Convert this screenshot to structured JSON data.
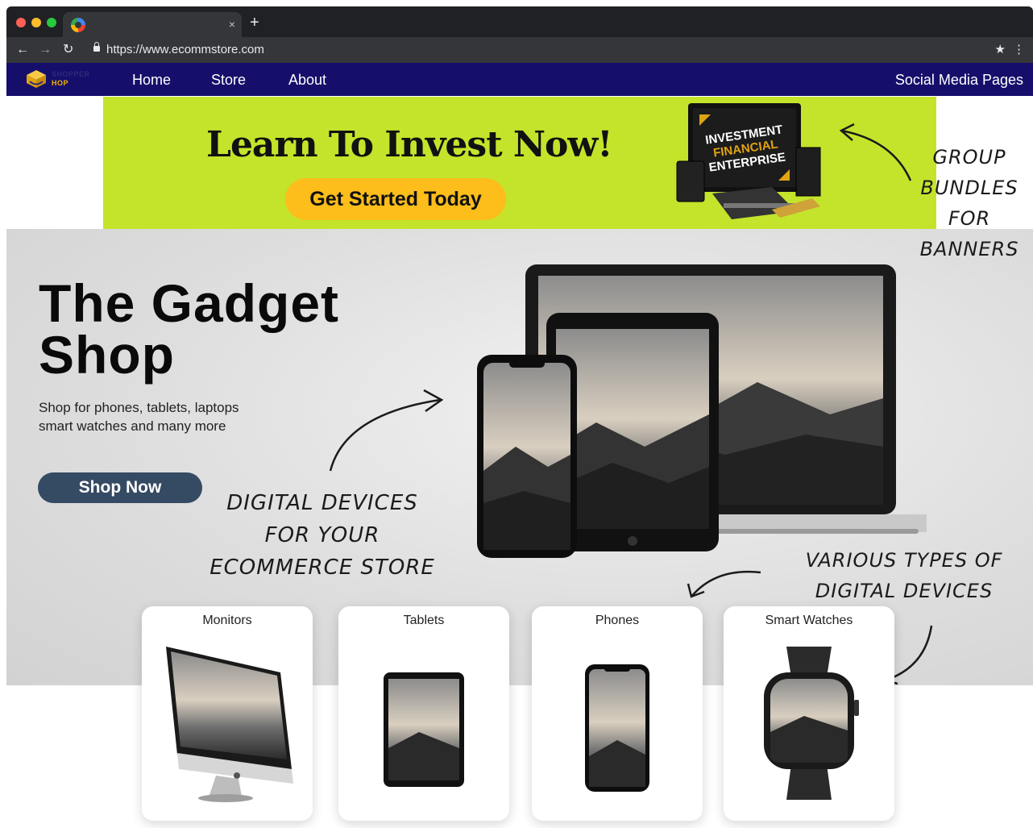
{
  "browser": {
    "tab_close": "×",
    "new_tab": "+",
    "url": "https://www.ecommstore.com",
    "icons": [
      "back-icon",
      "forward-icon",
      "reload-icon",
      "lock-icon",
      "star-icon",
      "kebab-menu-icon"
    ]
  },
  "site_nav": {
    "logo_line1": "SHOPPER",
    "logo_line2": "HOP",
    "links": [
      "Home",
      "Store",
      "About"
    ],
    "social": "Social Media Pages",
    "color": "#150f6b"
  },
  "banner": {
    "title": "Learn To Invest Now!",
    "cta": "Get Started Today",
    "product_line1": "INVESTMENT",
    "product_line2": "FINANCIAL",
    "product_line3": "ENTERPRISE",
    "background": "#c3e42b",
    "cta_color": "#fdbd1a"
  },
  "hero": {
    "title_line1": "The Gadget",
    "title_line2": "Shop",
    "subtitle_line1": "Shop for phones, tablets, laptops",
    "subtitle_line2": "smart watches and many more",
    "cta": "Shop Now",
    "cta_color": "#354a63"
  },
  "annotations": {
    "digital_line1": "DIGITAL DEVICES",
    "digital_line2": "FOR YOUR",
    "digital_line3": "ECOMMERCE STORE",
    "group_line1": "GROUP",
    "group_line2": "BUNDLES",
    "group_line3": "FOR",
    "group_line4": "BANNERS",
    "various_line1": "VARIOUS TYPES OF",
    "various_line2": "DIGITAL DEVICES"
  },
  "categories": [
    {
      "label": "Monitors"
    },
    {
      "label": "Tablets"
    },
    {
      "label": "Phones"
    },
    {
      "label": "Smart Watches"
    }
  ]
}
